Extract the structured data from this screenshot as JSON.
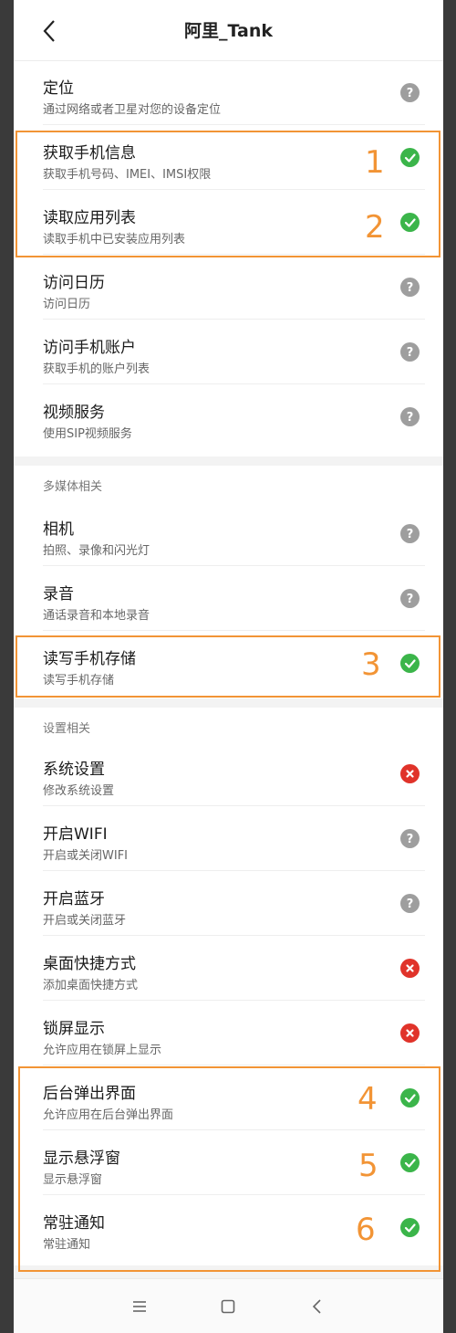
{
  "header": {
    "title": "阿里_Tank"
  },
  "rows": [
    {
      "title": "定位",
      "subtitle": "通过网络或者卫星对您的设备定位",
      "status": "unknown"
    },
    {
      "title": "获取手机信息",
      "subtitle": "获取手机号码、IMEI、IMSI权限",
      "status": "allowed"
    },
    {
      "title": "读取应用列表",
      "subtitle": "读取手机中已安装应用列表",
      "status": "allowed"
    },
    {
      "title": "访问日历",
      "subtitle": "访问日历",
      "status": "unknown"
    },
    {
      "title": "访问手机账户",
      "subtitle": "获取手机的账户列表",
      "status": "unknown"
    },
    {
      "title": "视频服务",
      "subtitle": "使用SIP视频服务",
      "status": "unknown"
    },
    {
      "title": "相机",
      "subtitle": "拍照、录像和闪光灯",
      "status": "unknown"
    },
    {
      "title": "录音",
      "subtitle": "通话录音和本地录音",
      "status": "unknown"
    },
    {
      "title": "读写手机存储",
      "subtitle": "读写手机存储",
      "status": "allowed"
    },
    {
      "title": "系统设置",
      "subtitle": "修改系统设置",
      "status": "denied"
    },
    {
      "title": "开启WIFI",
      "subtitle": "开启或关闭WIFI",
      "status": "unknown"
    },
    {
      "title": "开启蓝牙",
      "subtitle": "开启或关闭蓝牙",
      "status": "unknown"
    },
    {
      "title": "桌面快捷方式",
      "subtitle": "添加桌面快捷方式",
      "status": "denied"
    },
    {
      "title": "锁屏显示",
      "subtitle": "允许应用在锁屏上显示",
      "status": "denied"
    },
    {
      "title": "后台弹出界面",
      "subtitle": "允许应用在后台弹出界面",
      "status": "allowed"
    },
    {
      "title": "显示悬浮窗",
      "subtitle": "显示悬浮窗",
      "status": "allowed"
    },
    {
      "title": "常驻通知",
      "subtitle": "常驻通知",
      "status": "allowed"
    }
  ],
  "sections": {
    "multimedia": "多媒体相关",
    "settings": "设置相关"
  },
  "annotations": [
    "1",
    "2",
    "3",
    "4",
    "5",
    "6"
  ],
  "colors": {
    "allowed": "#3bb54a",
    "denied": "#e0332a",
    "unknown": "#9e9e9e",
    "annotation": "#f29435"
  },
  "icons": {
    "allowed": "check-circle-icon",
    "denied": "cross-circle-icon",
    "unknown": "question-circle-icon"
  }
}
